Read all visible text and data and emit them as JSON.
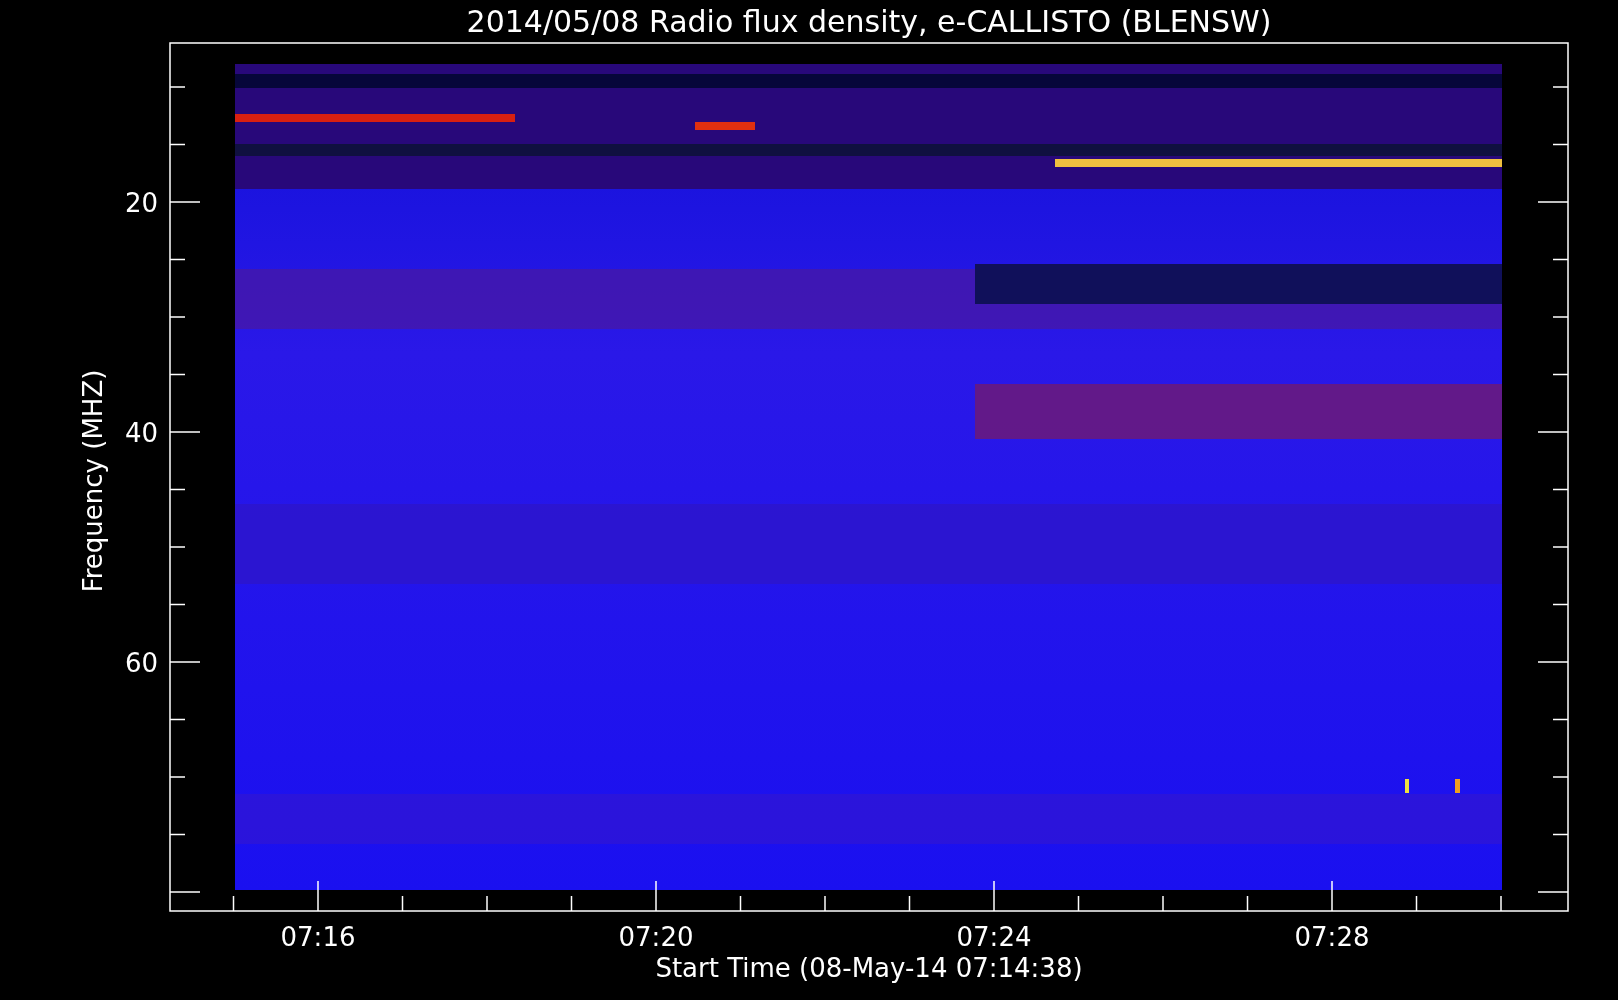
{
  "title": "2014/05/08  Radio flux density, e-CALLISTO (BLENSW)",
  "y_axis": {
    "label": "Frequency (MHZ)",
    "ticks": [
      "20",
      "40",
      "60"
    ]
  },
  "x_axis": {
    "label": "Start Time (08-May-14 07:14:38)",
    "ticks": [
      "07:16",
      "07:20",
      "07:24",
      "07:28"
    ]
  }
}
